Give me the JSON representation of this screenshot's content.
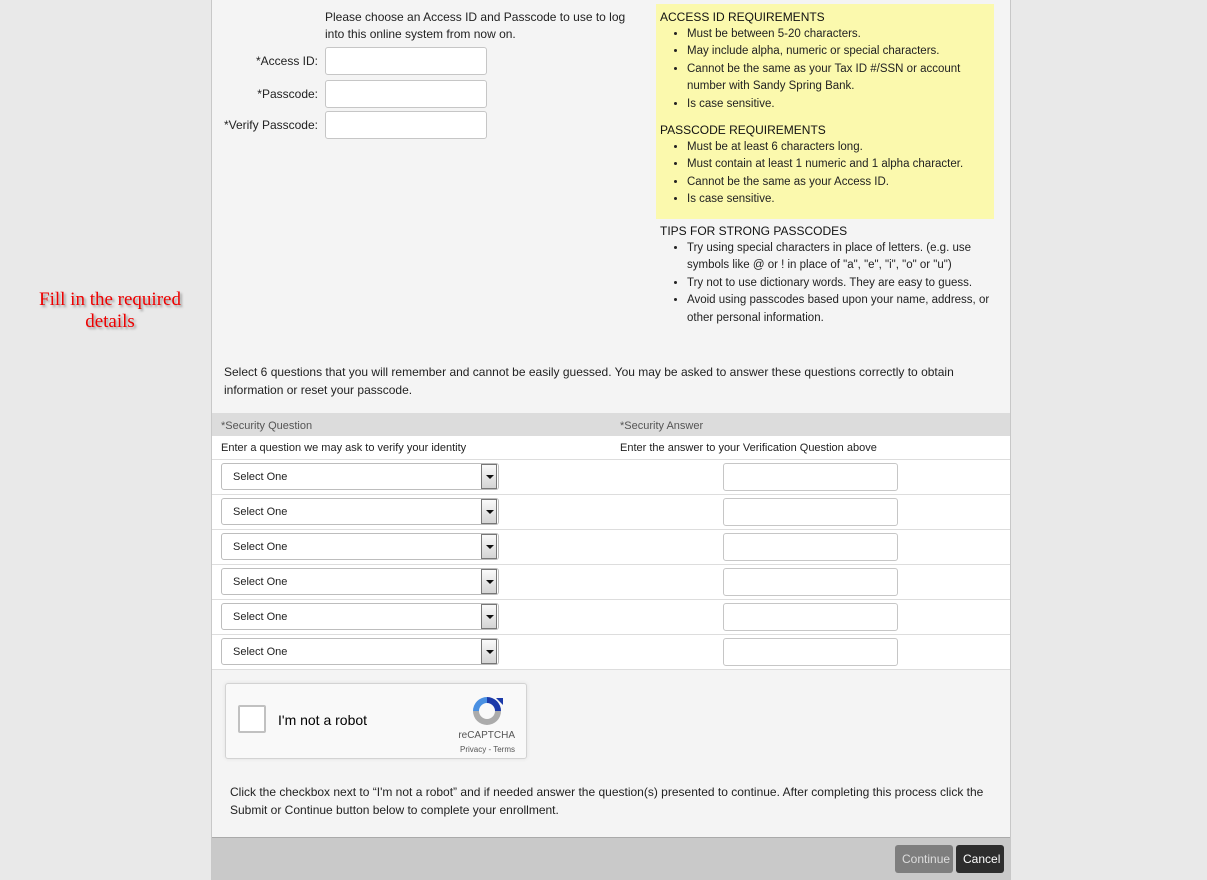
{
  "annotation": {
    "text": "Fill in the required details"
  },
  "credentials": {
    "intro": "Please choose an Access ID and Passcode to use to log into this online system from now on.",
    "access_id_label": "*Access ID:",
    "access_id_value": "",
    "passcode_label": "*Passcode:",
    "passcode_value": "",
    "verify_passcode_label": "*Verify Passcode:",
    "verify_passcode_value": ""
  },
  "requirements": {
    "access_id": {
      "title": "ACCESS ID REQUIREMENTS",
      "items": [
        "Must be between 5-20 characters.",
        "May include alpha, numeric or special characters.",
        "Cannot be the same as your Tax ID #/SSN or account number with Sandy Spring Bank.",
        "Is case sensitive."
      ]
    },
    "passcode": {
      "title": "PASSCODE REQUIREMENTS",
      "items": [
        "Must be at least 6 characters long.",
        "Must contain at least 1 numeric and 1 alpha character.",
        "Cannot be the same as your Access ID.",
        "Is case sensitive."
      ]
    },
    "tips": {
      "title": "TIPS FOR STRONG PASSCODES",
      "items": [
        "Try using special characters in place of letters. (e.g. use symbols like @ or ! in place of \"a\", \"e\", \"i\", \"o\" or \"u\")",
        "Try not to use dictionary words. They are easy to guess.",
        "Avoid using passcodes based upon your name, address, or other personal information."
      ]
    },
    "highlight_color": "#fbf9ad"
  },
  "security": {
    "intro": "Select 6 questions that you will remember and cannot be easily guessed. You may be asked to answer these questions correctly to obtain information or reset your passcode.",
    "question_header": "*Security Question",
    "answer_header": "*Security Answer",
    "question_hint": "Enter a question we may ask to verify your identity",
    "answer_hint": "Enter the answer to your Verification Question above",
    "rows": [
      {
        "question": "Select One",
        "answer": ""
      },
      {
        "question": "Select One",
        "answer": ""
      },
      {
        "question": "Select One",
        "answer": ""
      },
      {
        "question": "Select One",
        "answer": ""
      },
      {
        "question": "Select One",
        "answer": ""
      },
      {
        "question": "Select One",
        "answer": ""
      }
    ]
  },
  "captcha": {
    "label": "I'm not a robot",
    "brand": "reCAPTCHA",
    "links": "Privacy - Terms",
    "checked": false,
    "note": "Click the checkbox next to “I'm not a robot” and if needed answer the question(s) presented to continue. After completing this process click the Submit or Continue button below to complete your enrollment."
  },
  "footer": {
    "continue_label": "Continue",
    "cancel_label": "Cancel"
  }
}
